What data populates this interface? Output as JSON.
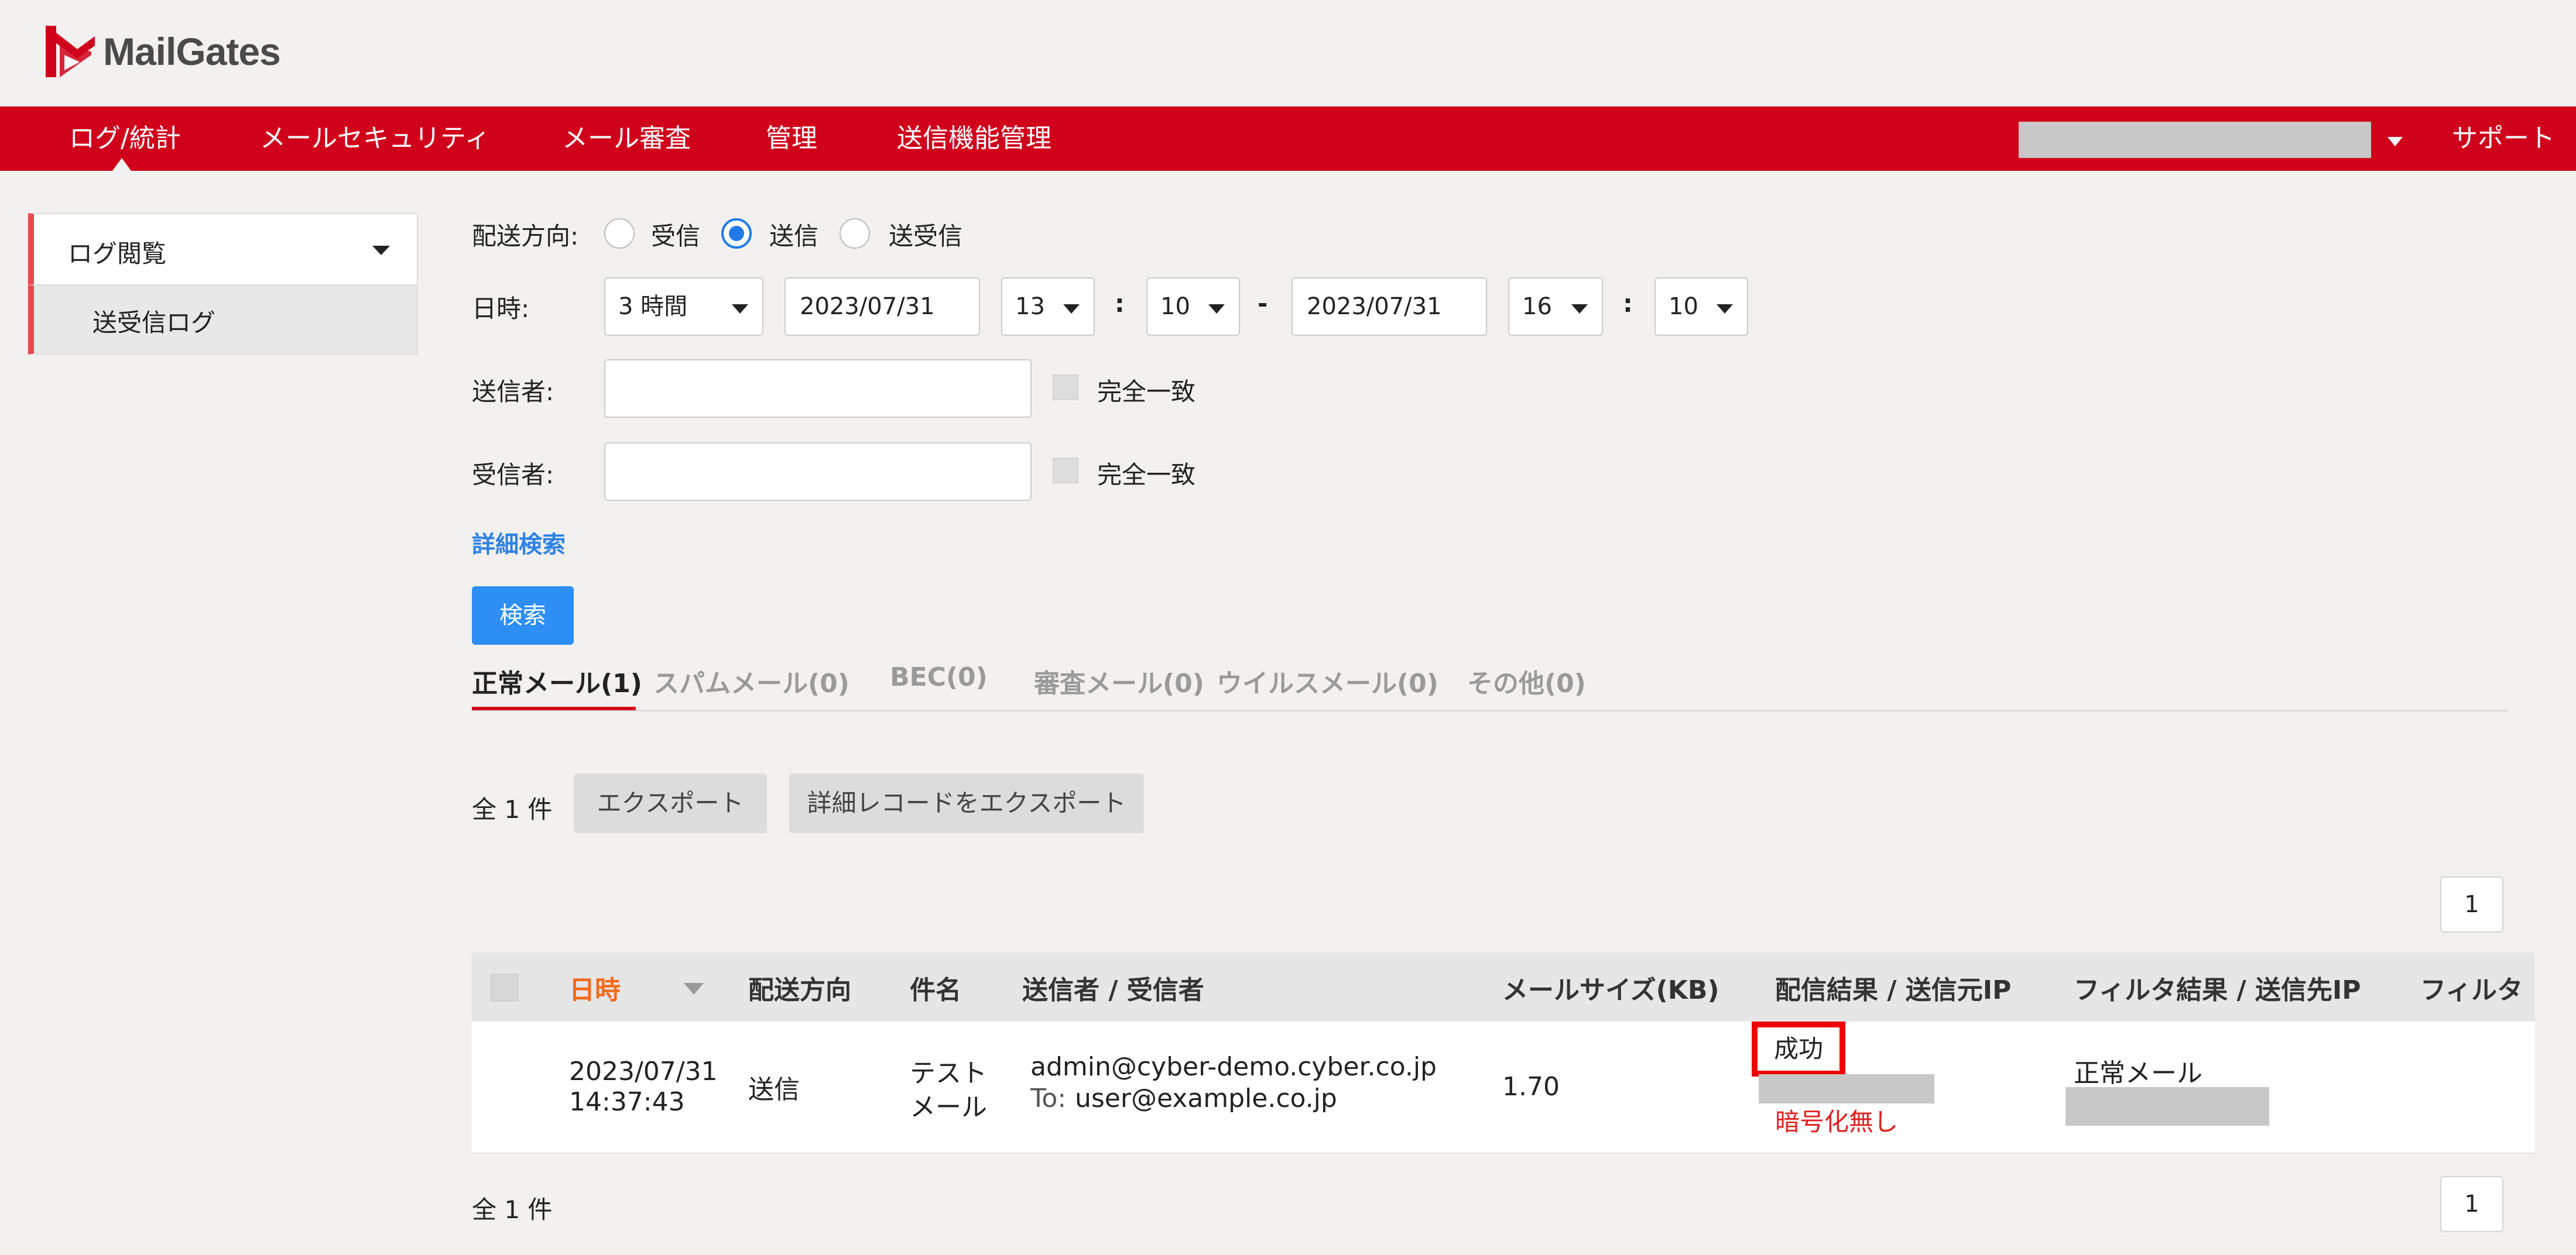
{
  "app": {
    "logo_text": "MailGates"
  },
  "nav": {
    "items": [
      "ログ/統計",
      "メールセキュリティ",
      "メール審査",
      "管理",
      "送信機能管理"
    ],
    "support": "サポート"
  },
  "sidebar": {
    "section": "ログ閲覧",
    "item": "送受信ログ"
  },
  "form": {
    "direction_label": "配送方向:",
    "directions": [
      "受信",
      "送信",
      "送受信"
    ],
    "selected_direction": "送信",
    "datetime_label": "日時:",
    "range": "3 時間",
    "from_date": "2023/07/31",
    "from_hour": "13",
    "from_min": "10",
    "to_date": "2023/07/31",
    "to_hour": "16",
    "to_min": "10",
    "colon": ":",
    "dash": "-",
    "sender_label": "送信者:",
    "recipient_label": "受信者:",
    "exact_match": "完全一致",
    "advanced": "詳細検索",
    "search_btn": "検索"
  },
  "tabs": [
    "正常メール(1)",
    "スパムメール(0)",
    "BEC(0)",
    "審査メール(0)",
    "ウイルスメール(0)",
    "その他(0)"
  ],
  "results": {
    "total": "全 1 件",
    "export": "エクスポート",
    "export_detail": "詳細レコードをエクスポート",
    "page": "1"
  },
  "table": {
    "headers": [
      "日時",
      "配送方向",
      "件名",
      "送信者 / 受信者",
      "メールサイズ(KB)",
      "配信結果 / 送信元IP",
      "フィルタ結果 / 送信先IP",
      "フィルタ"
    ],
    "row": {
      "date": "2023/07/31",
      "time": "14:37:43",
      "direction": "送信",
      "subject_line1": "テスト",
      "subject_line2": "メール",
      "sender": "admin@cyber-demo.cyber.co.jp",
      "to_prefix": "To:",
      "recipient": "user@example.co.jp",
      "size": "1.70",
      "delivery": "成功",
      "encryption": "暗号化無し",
      "filter_result": "正常メール"
    }
  },
  "colors": {
    "brand": "#d0021b",
    "accent_blue": "#2d8ef5",
    "sort_active": "#f26a1b"
  }
}
